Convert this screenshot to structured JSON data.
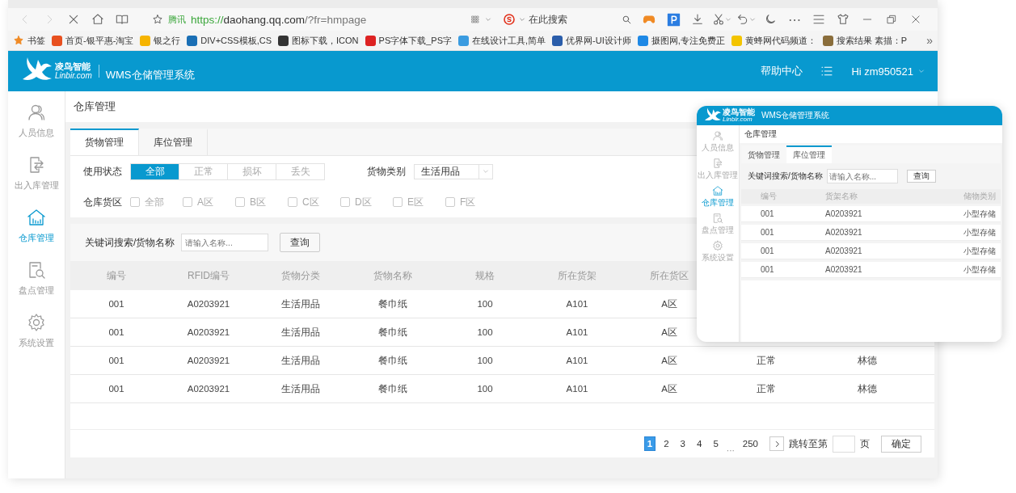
{
  "browser": {
    "address": {
      "site_label": "腾讯",
      "scheme": "https://",
      "host": "daohang.qq.com",
      "path": "/?fr=hmpage"
    },
    "search_placeholder": "在此搜索",
    "more": "⋯",
    "bookmarks": [
      {
        "label": "书签"
      },
      {
        "label": "首页-银平惠-淘宝"
      },
      {
        "label": "银之行"
      },
      {
        "label": "DIV+CSS模板,CS"
      },
      {
        "label": "图标下载，ICON"
      },
      {
        "label": "PS字体下载_PS字"
      },
      {
        "label": "在线设计工具,简单"
      },
      {
        "label": "优界网-UI设计师"
      },
      {
        "label": "摄图网,专注免费正"
      },
      {
        "label": "黄蜂网代码频道："
      },
      {
        "label": "搜索结果 素描：P"
      }
    ],
    "bookmarks_more": "»"
  },
  "app": {
    "brand": "凌鸟智能",
    "brand_domain": "Linbir.com",
    "title": "WMS仓储管理系统",
    "help": "帮助中心",
    "user": "Hi zm950521"
  },
  "sidebar": [
    {
      "label": "人员信息",
      "selected": false
    },
    {
      "label": "出入库管理",
      "selected": false
    },
    {
      "label": "仓库管理",
      "selected": true
    },
    {
      "label": "盘点管理",
      "selected": false
    },
    {
      "label": "系统设置",
      "selected": false
    }
  ],
  "page_title": "仓库管理",
  "tabs": [
    {
      "label": "货物管理",
      "selected": true
    },
    {
      "label": "库位管理",
      "selected": false
    }
  ],
  "filters": {
    "status_label": "使用状态",
    "status_options": [
      {
        "label": "全部",
        "selected": true
      },
      {
        "label": "正常",
        "selected": false
      },
      {
        "label": "损坏",
        "selected": false
      },
      {
        "label": "丢失",
        "selected": false
      }
    ],
    "category_label": "货物类别",
    "category_value": "生活用品",
    "zone_label": "仓库货区",
    "zones": [
      {
        "label": "全部",
        "checked": false
      },
      {
        "label": "A区",
        "checked": false
      },
      {
        "label": "B区",
        "checked": false
      },
      {
        "label": "C区",
        "checked": false
      },
      {
        "label": "D区",
        "checked": false
      },
      {
        "label": "E区",
        "checked": false
      },
      {
        "label": "F区",
        "checked": false
      }
    ]
  },
  "search": {
    "label": "关键词搜索/货物名称",
    "placeholder": "请输入名称...",
    "button": "查询"
  },
  "table": {
    "columns": [
      "编号",
      "RFID编号",
      "货物分类",
      "货物名称",
      "规格",
      "所在货架",
      "所在货区"
    ],
    "rows": [
      {
        "cells": [
          "001",
          "A0203921",
          "生活用品",
          "餐巾纸",
          "100",
          "A101",
          "A区"
        ]
      },
      {
        "cells": [
          "001",
          "A0203921",
          "生活用品",
          "餐巾纸",
          "100",
          "A101",
          "A区"
        ]
      },
      {
        "cells": [
          "001",
          "A0203921",
          "生活用品",
          "餐巾纸",
          "100",
          "A101",
          "A区",
          "正常",
          "林德"
        ]
      },
      {
        "cells": [
          "001",
          "A0203921",
          "生活用品",
          "餐巾纸",
          "100",
          "A101",
          "A区",
          "正常",
          "林德"
        ]
      }
    ]
  },
  "pagination": {
    "pages": [
      {
        "kind": "page",
        "label": "1",
        "selected": true
      },
      {
        "kind": "page",
        "label": "2",
        "selected": false
      },
      {
        "kind": "page",
        "label": "3",
        "selected": false
      },
      {
        "kind": "page",
        "label": "4",
        "selected": false
      },
      {
        "kind": "page",
        "label": "5",
        "selected": false
      },
      {
        "kind": "ellipsis",
        "label": "···",
        "selected": false
      },
      {
        "kind": "page",
        "label": "250",
        "selected": false
      }
    ],
    "jump_label": "跳转至第",
    "page_unit": "页",
    "confirm": "确定"
  },
  "preview": {
    "brand": "凌鸟智能",
    "brand_domain": "Linbir.com",
    "title": "WMS仓储管理系统",
    "sidebar": [
      {
        "label": "人员信息",
        "selected": false
      },
      {
        "label": "出入库管理",
        "selected": false
      },
      {
        "label": "仓库管理",
        "selected": true
      },
      {
        "label": "盘点管理",
        "selected": false
      },
      {
        "label": "系统设置",
        "selected": false
      }
    ],
    "page_title": "仓库管理",
    "tabs": [
      {
        "label": "货物管理",
        "selected": false
      },
      {
        "label": "库位管理",
        "selected": true
      }
    ],
    "search": {
      "label": "关键词搜索/货物名称",
      "placeholder": "请输入名称...",
      "button": "查询"
    },
    "table": {
      "columns": [
        "编号",
        "货架名称",
        "储物类别"
      ],
      "rows": [
        {
          "cells": [
            "001",
            "A0203921",
            "小型存储"
          ]
        },
        {
          "cells": [
            "001",
            "A0203921",
            "小型存储"
          ]
        },
        {
          "cells": [
            "001",
            "A0203921",
            "小型存储"
          ]
        },
        {
          "cells": [
            "001",
            "A0203921",
            "小型存储"
          ]
        }
      ]
    }
  }
}
